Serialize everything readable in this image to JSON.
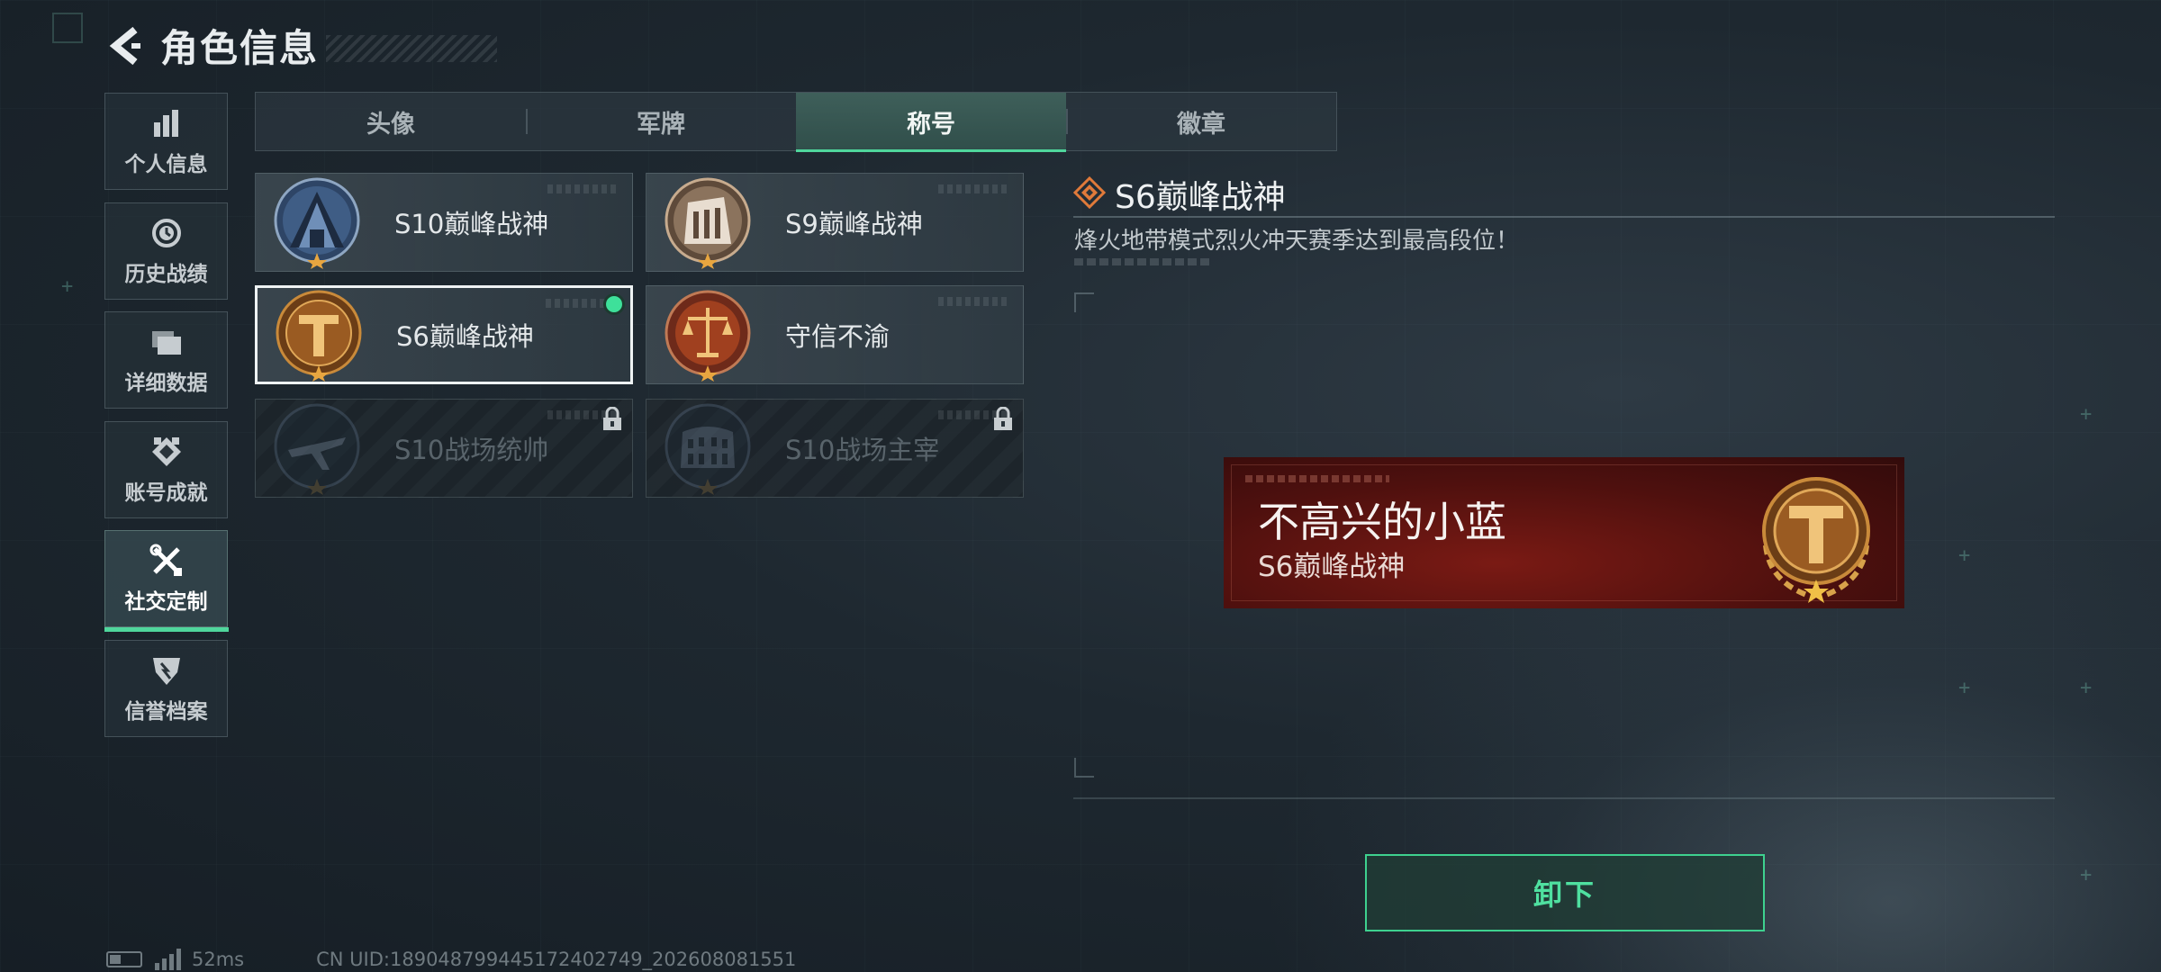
{
  "header": {
    "title": "角色信息"
  },
  "sidebar": {
    "items": [
      {
        "label": "个人信息",
        "icon": "bar-chart-icon",
        "active": false
      },
      {
        "label": "历史战绩",
        "icon": "history-clock-icon",
        "active": false
      },
      {
        "label": "详细数据",
        "icon": "folder-icon",
        "active": false
      },
      {
        "label": "账号成就",
        "icon": "achievement-icon",
        "active": false
      },
      {
        "label": "社交定制",
        "icon": "tools-icon",
        "active": true
      },
      {
        "label": "信誉档案",
        "icon": "reputation-icon",
        "active": false
      }
    ]
  },
  "tabs": [
    {
      "label": "头像",
      "active": false
    },
    {
      "label": "军牌",
      "active": false
    },
    {
      "label": "称号",
      "active": true
    },
    {
      "label": "徽章",
      "active": false
    }
  ],
  "titles": [
    {
      "name": "S10巅峰战神",
      "emblem": "blue-tower-emblem",
      "state": "normal"
    },
    {
      "name": "S9巅峰战神",
      "emblem": "bronze-building-emblem",
      "state": "normal"
    },
    {
      "name": "S6巅峰战神",
      "emblem": "gold-t-emblem",
      "state": "selected-equipped"
    },
    {
      "name": "守信不渝",
      "emblem": "red-scales-emblem",
      "state": "normal"
    },
    {
      "name": "S10战场统帅",
      "emblem": "plane-emblem",
      "state": "locked"
    },
    {
      "name": "S10战场主宰",
      "emblem": "colosseum-emblem",
      "state": "locked"
    }
  ],
  "detail": {
    "title": "S6巅峰战神",
    "description": "烽火地带模式烈火冲天赛季达到最高段位！"
  },
  "preview": {
    "player_name": "不高兴的小蓝",
    "title": "S6巅峰战神"
  },
  "actions": {
    "unequip_label": "卸下"
  },
  "status": {
    "ping": "52ms",
    "uid": "CN UID:189048799445172402749_202608081551"
  },
  "colors": {
    "accent": "#4fd69c",
    "preview_bg": "#5a120f",
    "gold": "#c98a3a"
  }
}
